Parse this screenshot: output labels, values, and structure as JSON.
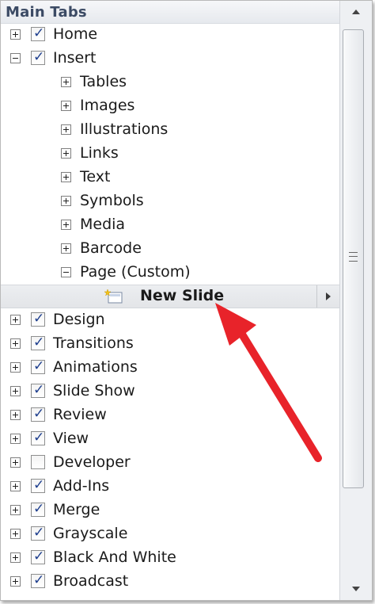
{
  "header": {
    "title": "Main Tabs"
  },
  "tree": {
    "top_before": [
      {
        "label": "Home",
        "checked": true,
        "expanded": false
      },
      {
        "label": "Insert",
        "checked": true,
        "expanded": true
      }
    ],
    "insert_groups": [
      {
        "label": "Tables",
        "expanded": false
      },
      {
        "label": "Images",
        "expanded": false
      },
      {
        "label": "Illustrations",
        "expanded": false
      },
      {
        "label": "Links",
        "expanded": false
      },
      {
        "label": "Text",
        "expanded": false
      },
      {
        "label": "Symbols",
        "expanded": false
      },
      {
        "label": "Media",
        "expanded": false
      },
      {
        "label": "Barcode",
        "expanded": false
      },
      {
        "label": "Page (Custom)",
        "expanded": true
      }
    ],
    "custom_command": {
      "label": "New Slide"
    },
    "top_after": [
      {
        "label": "Design",
        "checked": true
      },
      {
        "label": "Transitions",
        "checked": true
      },
      {
        "label": "Animations",
        "checked": true
      },
      {
        "label": "Slide Show",
        "checked": true
      },
      {
        "label": "Review",
        "checked": true
      },
      {
        "label": "View",
        "checked": true
      },
      {
        "label": "Developer",
        "checked": false
      },
      {
        "label": "Add-Ins",
        "checked": true
      },
      {
        "label": "Merge",
        "checked": true
      },
      {
        "label": "Grayscale",
        "checked": true
      },
      {
        "label": "Black And White",
        "checked": true
      },
      {
        "label": "Broadcast",
        "checked": true
      }
    ]
  },
  "colors": {
    "checkmark": "#1e3f8e",
    "annotation_arrow": "#e8232a",
    "selected_row_bg": "#e6e8eb"
  },
  "icons": {
    "expand": "plus-box-icon",
    "collapse": "minus-box-icon",
    "command": "new-slide-icon",
    "submenu": "chevron-right-icon"
  }
}
